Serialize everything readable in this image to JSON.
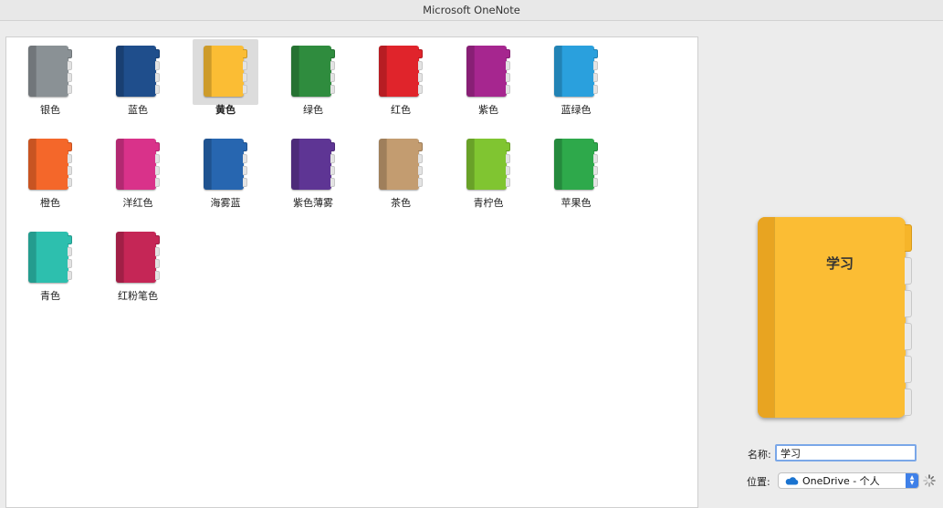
{
  "window": {
    "title": "Microsoft OneNote"
  },
  "notebook_colors": [
    {
      "label": "银色",
      "color": "#8a9195",
      "selected": false
    },
    {
      "label": "蓝色",
      "color": "#1f4e8c",
      "selected": false
    },
    {
      "label": "黄色",
      "color": "#fbbd34",
      "selected": true
    },
    {
      "label": "绿色",
      "color": "#2f8c3e",
      "selected": false
    },
    {
      "label": "红色",
      "color": "#e0242b",
      "selected": false
    },
    {
      "label": "紫色",
      "color": "#a6268f",
      "selected": false
    },
    {
      "label": "蓝绿色",
      "color": "#2aa0dd",
      "selected": false
    },
    {
      "label": "橙色",
      "color": "#f4672a",
      "selected": false
    },
    {
      "label": "洋红色",
      "color": "#d9328a",
      "selected": false
    },
    {
      "label": "海雾蓝",
      "color": "#2766b0",
      "selected": false
    },
    {
      "label": "紫色薄雾",
      "color": "#5e3594",
      "selected": false
    },
    {
      "label": "茶色",
      "color": "#c39c70",
      "selected": false
    },
    {
      "label": "青柠色",
      "color": "#80c531",
      "selected": false
    },
    {
      "label": "苹果色",
      "color": "#2ea94b",
      "selected": false
    },
    {
      "label": "青色",
      "color": "#2dbfae",
      "selected": false
    },
    {
      "label": "红粉笔色",
      "color": "#c52656",
      "selected": false
    }
  ],
  "preview": {
    "title": "学习",
    "color": "#fbbd34"
  },
  "form": {
    "name_label": "名称:",
    "name_value": "学习",
    "location_label": "位置:",
    "location_value": "OneDrive - 个人"
  },
  "icons": {
    "cloud": "onedrive-cloud-icon",
    "stepper": "popup-stepper-icon",
    "spinner": "loading-spinner-icon"
  }
}
